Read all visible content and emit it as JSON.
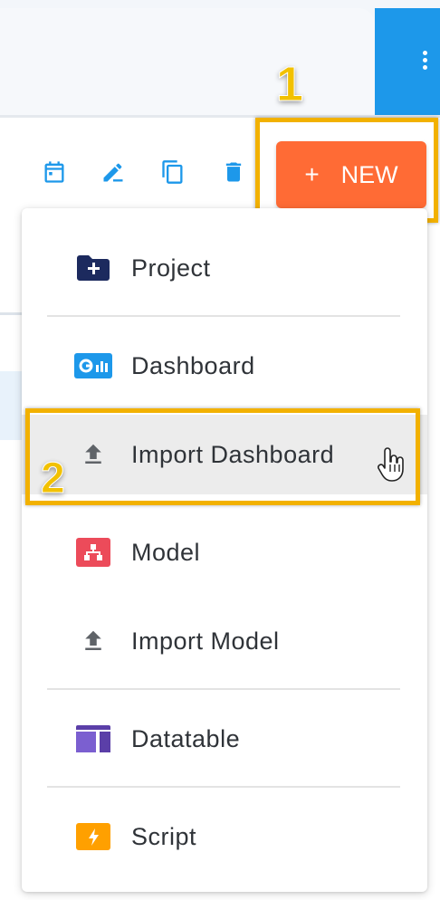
{
  "callouts": {
    "first": "1",
    "second": "2"
  },
  "toolbar": {
    "icons": [
      "calendar-icon",
      "edit-icon",
      "copy-icon",
      "delete-icon"
    ],
    "new_button": {
      "plus": "+",
      "label": "NEW"
    }
  },
  "menu": {
    "items": [
      {
        "label": "Project",
        "icon": "folder-plus-icon",
        "color": "#1c2a5e"
      },
      {
        "label": "Dashboard",
        "icon": "dashboard-icon",
        "color": "#1d98ea"
      },
      {
        "label": "Import Dashboard",
        "icon": "upload-icon",
        "color": "#5f6368",
        "hovered": true
      },
      {
        "label": "Model",
        "icon": "model-icon",
        "color": "#ec4b5a"
      },
      {
        "label": "Import Model",
        "icon": "upload-icon",
        "color": "#5f6368"
      },
      {
        "label": "Datatable",
        "icon": "datatable-icon",
        "color": "#5b3fa8"
      },
      {
        "label": "Script",
        "icon": "script-icon",
        "color": "#ffa000"
      }
    ]
  },
  "colors": {
    "accent": "#ff6b35",
    "header_blue": "#1d98ea",
    "callout": "#f2b100",
    "toolbar_icon": "#1d98ea"
  }
}
